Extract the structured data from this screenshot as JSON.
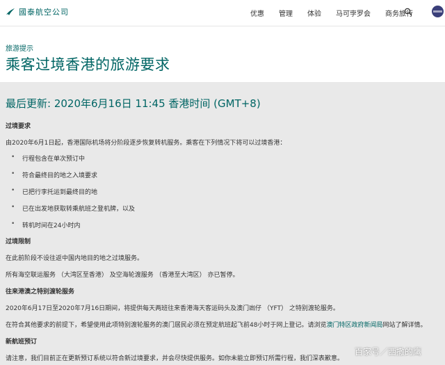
{
  "header": {
    "logo_text": "國泰航空公司",
    "nav": [
      "优惠",
      "管理",
      "体验",
      "马可孛罗会",
      "商务旅行"
    ]
  },
  "breadcrumb": "旅游提示",
  "page_title": "乘客过境香港的旅游要求",
  "updated": "最后更新: 2020年6月16日 11:45 香港时间 (GMT+8)",
  "sections": {
    "transit_req": {
      "heading": "过境要求",
      "intro": "由2020年6月1日起，香港国际机场将分阶段逐步恢复转机服务。乘客在下列情况下将可以过境香港：",
      "items": [
        "行程包含在单次预订中",
        "符合最终目的地之入境要求",
        "已把行李托运到最终目的地",
        "已在出发地获取转乘航班之登机牌，以及",
        "转机时间在24小时内"
      ]
    },
    "restrictions": {
      "heading": "过境限制",
      "p1": "在此前阶段不设往返中国内地目的地之过境服务。",
      "p2": "所有海空联运服务 （大湾区至香港） 及空海轮渡服务 （香港至大湾区） 亦已暂停。"
    },
    "ferry": {
      "heading": "往来港澳之特别渡轮服务",
      "p1": "2020年6月17日至2020年7月16日期间，将提供每天两班往来香港海天客运码头及澳门凼仔 （YFT） 之特别渡轮服务。",
      "p2_before": "在符合其他要求的前提下，希望使用此项特别渡轮服务的澳门居民必须在预定航班起飞前48小时于网上登记。请浏览",
      "p2_link": "澳门特区政府新闻局",
      "p2_after": "网站了解详情。"
    },
    "booking": {
      "heading": "新航班预订",
      "p1": "请注意，我们目前正在更新预订系统以符合新过境要求，并会尽快提供服务。如你未能立即预订所需行程，我们深表歉意。"
    }
  },
  "watermark": "百家号／西撒的鹰",
  "colors": {
    "brand": "#006564",
    "content_bg": "#e9e9e9"
  }
}
